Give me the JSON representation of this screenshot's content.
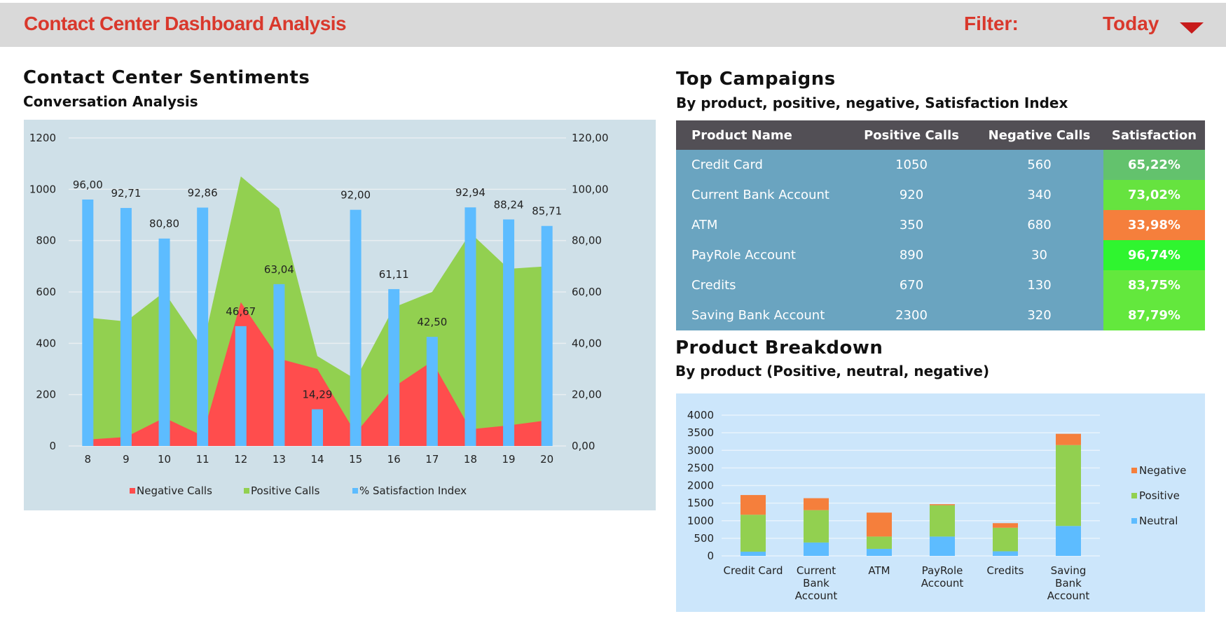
{
  "header": {
    "title": "Contact Center Dashboard Analysis",
    "filter_label": "Filter:",
    "filter_value": "Today"
  },
  "sentiments": {
    "title": "Contact Center Sentiments",
    "subtitle": "Conversation Analysis"
  },
  "campaigns": {
    "title": "Top Campaigns",
    "subtitle": "By product, positive, negative, Satisfaction Index",
    "columns": [
      "Product Name",
      "Positive Calls",
      "Negative Calls",
      "Satisfaction"
    ],
    "rows": [
      {
        "name": "Credit Card",
        "positive": "1050",
        "negative": "560",
        "satisfaction": "65,22%",
        "color": "#63c26d"
      },
      {
        "name": "Current Bank Account",
        "positive": "920",
        "negative": "340",
        "satisfaction": "73,02%",
        "color": "#66e33f"
      },
      {
        "name": "ATM",
        "positive": "350",
        "negative": "680",
        "satisfaction": "33,98%",
        "color": "#f57f3c"
      },
      {
        "name": "PayRole Account",
        "positive": "890",
        "negative": "30",
        "satisfaction": "96,74%",
        "color": "#2ff52f"
      },
      {
        "name": "Credits",
        "positive": "670",
        "negative": "130",
        "satisfaction": "83,75%",
        "color": "#63e83d"
      },
      {
        "name": "Saving Bank Account",
        "positive": "2300",
        "negative": "320",
        "satisfaction": "87,79%",
        "color": "#63e83d"
      }
    ]
  },
  "breakdown": {
    "title": "Product Breakdown",
    "subtitle": "By product (Positive, neutral, negative)"
  },
  "chart_data": [
    {
      "type": "area",
      "categories": [
        "8",
        "9",
        "10",
        "11",
        "12",
        "13",
        "14",
        "15",
        "16",
        "17",
        "18",
        "19",
        "20"
      ],
      "series": [
        {
          "name": "Negative Calls",
          "kind": "area",
          "axis": "left",
          "color": "#ff4d4d",
          "values": [
            25,
            35,
            110,
            40,
            560,
            340,
            300,
            50,
            230,
            330,
            65,
            80,
            100
          ]
        },
        {
          "name": "Positive Calls",
          "kind": "area",
          "axis": "left",
          "color": "#92d050",
          "values": [
            500,
            485,
            600,
            380,
            1050,
            925,
            350,
            260,
            540,
            600,
            830,
            690,
            700
          ]
        },
        {
          "name": "% Satisfaction Index",
          "kind": "bar",
          "axis": "right",
          "color": "#5dbcff",
          "values": [
            96.0,
            92.71,
            80.8,
            92.86,
            46.67,
            63.04,
            14.29,
            92.0,
            61.11,
            42.5,
            92.94,
            88.24,
            85.71
          ],
          "labels": [
            "96,00",
            "92,71",
            "80,80",
            "92,86",
            "46,67",
            "63,04",
            "14,29",
            "92,00",
            "61,11",
            "42,50",
            "92,94",
            "88,24",
            "85,71"
          ]
        }
      ],
      "yticks_left": [
        "0",
        "200",
        "400",
        "600",
        "800",
        "1000",
        "1200"
      ],
      "yticks_right": [
        "0,00",
        "20,00",
        "40,00",
        "60,00",
        "80,00",
        "100,00",
        "120,00"
      ],
      "ylim_left": [
        0,
        1200
      ],
      "ylim_right": [
        0,
        120
      ],
      "grid": true,
      "legend": "bottom"
    },
    {
      "type": "bar",
      "stacked": true,
      "categories": [
        [
          "Credit Card"
        ],
        [
          "Current",
          "Bank",
          "Account"
        ],
        [
          "ATM"
        ],
        [
          "PayRole",
          "Account"
        ],
        [
          "Credits"
        ],
        [
          "Saving",
          "Bank",
          "Account"
        ]
      ],
      "series": [
        {
          "name": "Neutral",
          "color": "#5dbcff",
          "values": [
            120,
            380,
            200,
            550,
            130,
            850
          ]
        },
        {
          "name": "Positive",
          "color": "#92d050",
          "values": [
            1050,
            920,
            350,
            890,
            670,
            2300
          ]
        },
        {
          "name": "Negative",
          "color": "#f57f3c",
          "values": [
            560,
            340,
            680,
            30,
            130,
            320
          ]
        }
      ],
      "yticks": [
        "0",
        "500",
        "1000",
        "1500",
        "2000",
        "2500",
        "3000",
        "3500",
        "4000"
      ],
      "ylim": [
        0,
        4000
      ],
      "grid": true,
      "legend": "right"
    }
  ]
}
